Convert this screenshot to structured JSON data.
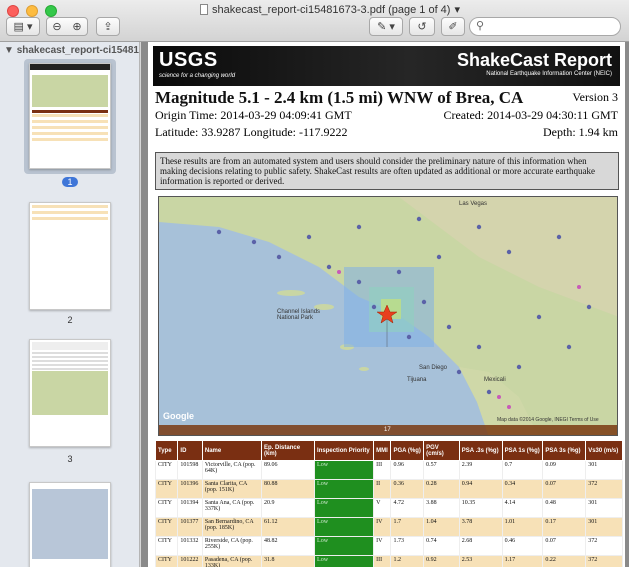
{
  "window": {
    "title": "shakecast_report-ci15481673-3.pdf (page 1 of 4)",
    "search_placeholder": ""
  },
  "sidebar": {
    "header": "shakecast_report-ci1548167",
    "pages": [
      "1",
      "2",
      "3"
    ]
  },
  "report": {
    "logo": "USGS",
    "logo_tagline": "science for a changing world",
    "banner_title": "ShakeCast Report",
    "banner_subtitle": "National Earthquake Information Center (NEIC)",
    "heading": "Magnitude 5.1 - 2.4 km (1.5 mi) WNW of Brea, CA",
    "version": "Version 3",
    "origin_time": "Origin Time: 2014-03-29 04:09:41 GMT",
    "created": "Created: 2014-03-29 04:30:11 GMT",
    "location": "Latitude: 33.9287 Longitude: -117.9222",
    "depth": "Depth: 1.94 km",
    "notice": "These results are from an automated system and users should consider the preliminary nature of this information when making decisions relating to public safety. ShakeCast results are often updated as additional or more accurate earthquake information is reported or derived."
  },
  "map": {
    "labels": {
      "las_vegas": "Las Vegas",
      "san_diego": "San Diego",
      "tijuana": "Tijuana",
      "mexicali": "Mexicali",
      "channel_islands": "Channel Islands National Park",
      "google": "Google",
      "map_data": "Map data ©2014 Google, INEGI   Terms of Use",
      "scale": "17"
    },
    "colors": {
      "land": "#c9d6a4",
      "ocean": "#a7c1d9",
      "shake": "#7fb0e6",
      "epicenter": "#e8401e"
    }
  },
  "table": {
    "headers": [
      "Type",
      "ID",
      "Name",
      "Ep. Distance (km)",
      "Inspection Priority",
      "MMI",
      "PGA (%g)",
      "PGV (cm/s)",
      "PSA .3s (%g)",
      "PSA 1s (%g)",
      "PSA 3s (%g)",
      "Vs30 (m/s)"
    ],
    "rows": [
      [
        "CITY",
        "101598",
        "Victorville, CA (pop. 64K)",
        "89.06",
        "Low",
        "III",
        "0.96",
        "0.57",
        "2.39",
        "0.7",
        "0.09",
        "301"
      ],
      [
        "CITY",
        "101396",
        "Santa Clarita, CA (pop. 151K)",
        "80.88",
        "Low",
        "II",
        "0.36",
        "0.28",
        "0.94",
        "0.34",
        "0.07",
        "372"
      ],
      [
        "CITY",
        "101394",
        "Santa Ana, CA (pop. 337K)",
        "20.9",
        "Low",
        "V",
        "4.72",
        "3.88",
        "10.35",
        "4.14",
        "0.48",
        "301"
      ],
      [
        "CITY",
        "101377",
        "San Bernardino, CA (pop. 185K)",
        "61.12",
        "Low",
        "IV",
        "1.7",
        "1.04",
        "3.78",
        "1.01",
        "0.17",
        "301"
      ],
      [
        "CITY",
        "101332",
        "Riverside, CA (pop. 255K)",
        "48.82",
        "Low",
        "IV",
        "1.73",
        "0.74",
        "2.68",
        "0.46",
        "0.07",
        "372"
      ],
      [
        "CITY",
        "101222",
        "Pasadena, CA (pop. 133K)",
        "31.8",
        "Low",
        "III",
        "1.2",
        "0.92",
        "2.53",
        "1.17",
        "0.22",
        "372"
      ],
      [
        "CITY",
        "101173",
        "Ontario, CA (pop. 158K)",
        "29.23",
        "Low",
        "V",
        "5.21",
        "3.3",
        "10.95",
        "2.26",
        "0.24",
        "372"
      ]
    ]
  }
}
